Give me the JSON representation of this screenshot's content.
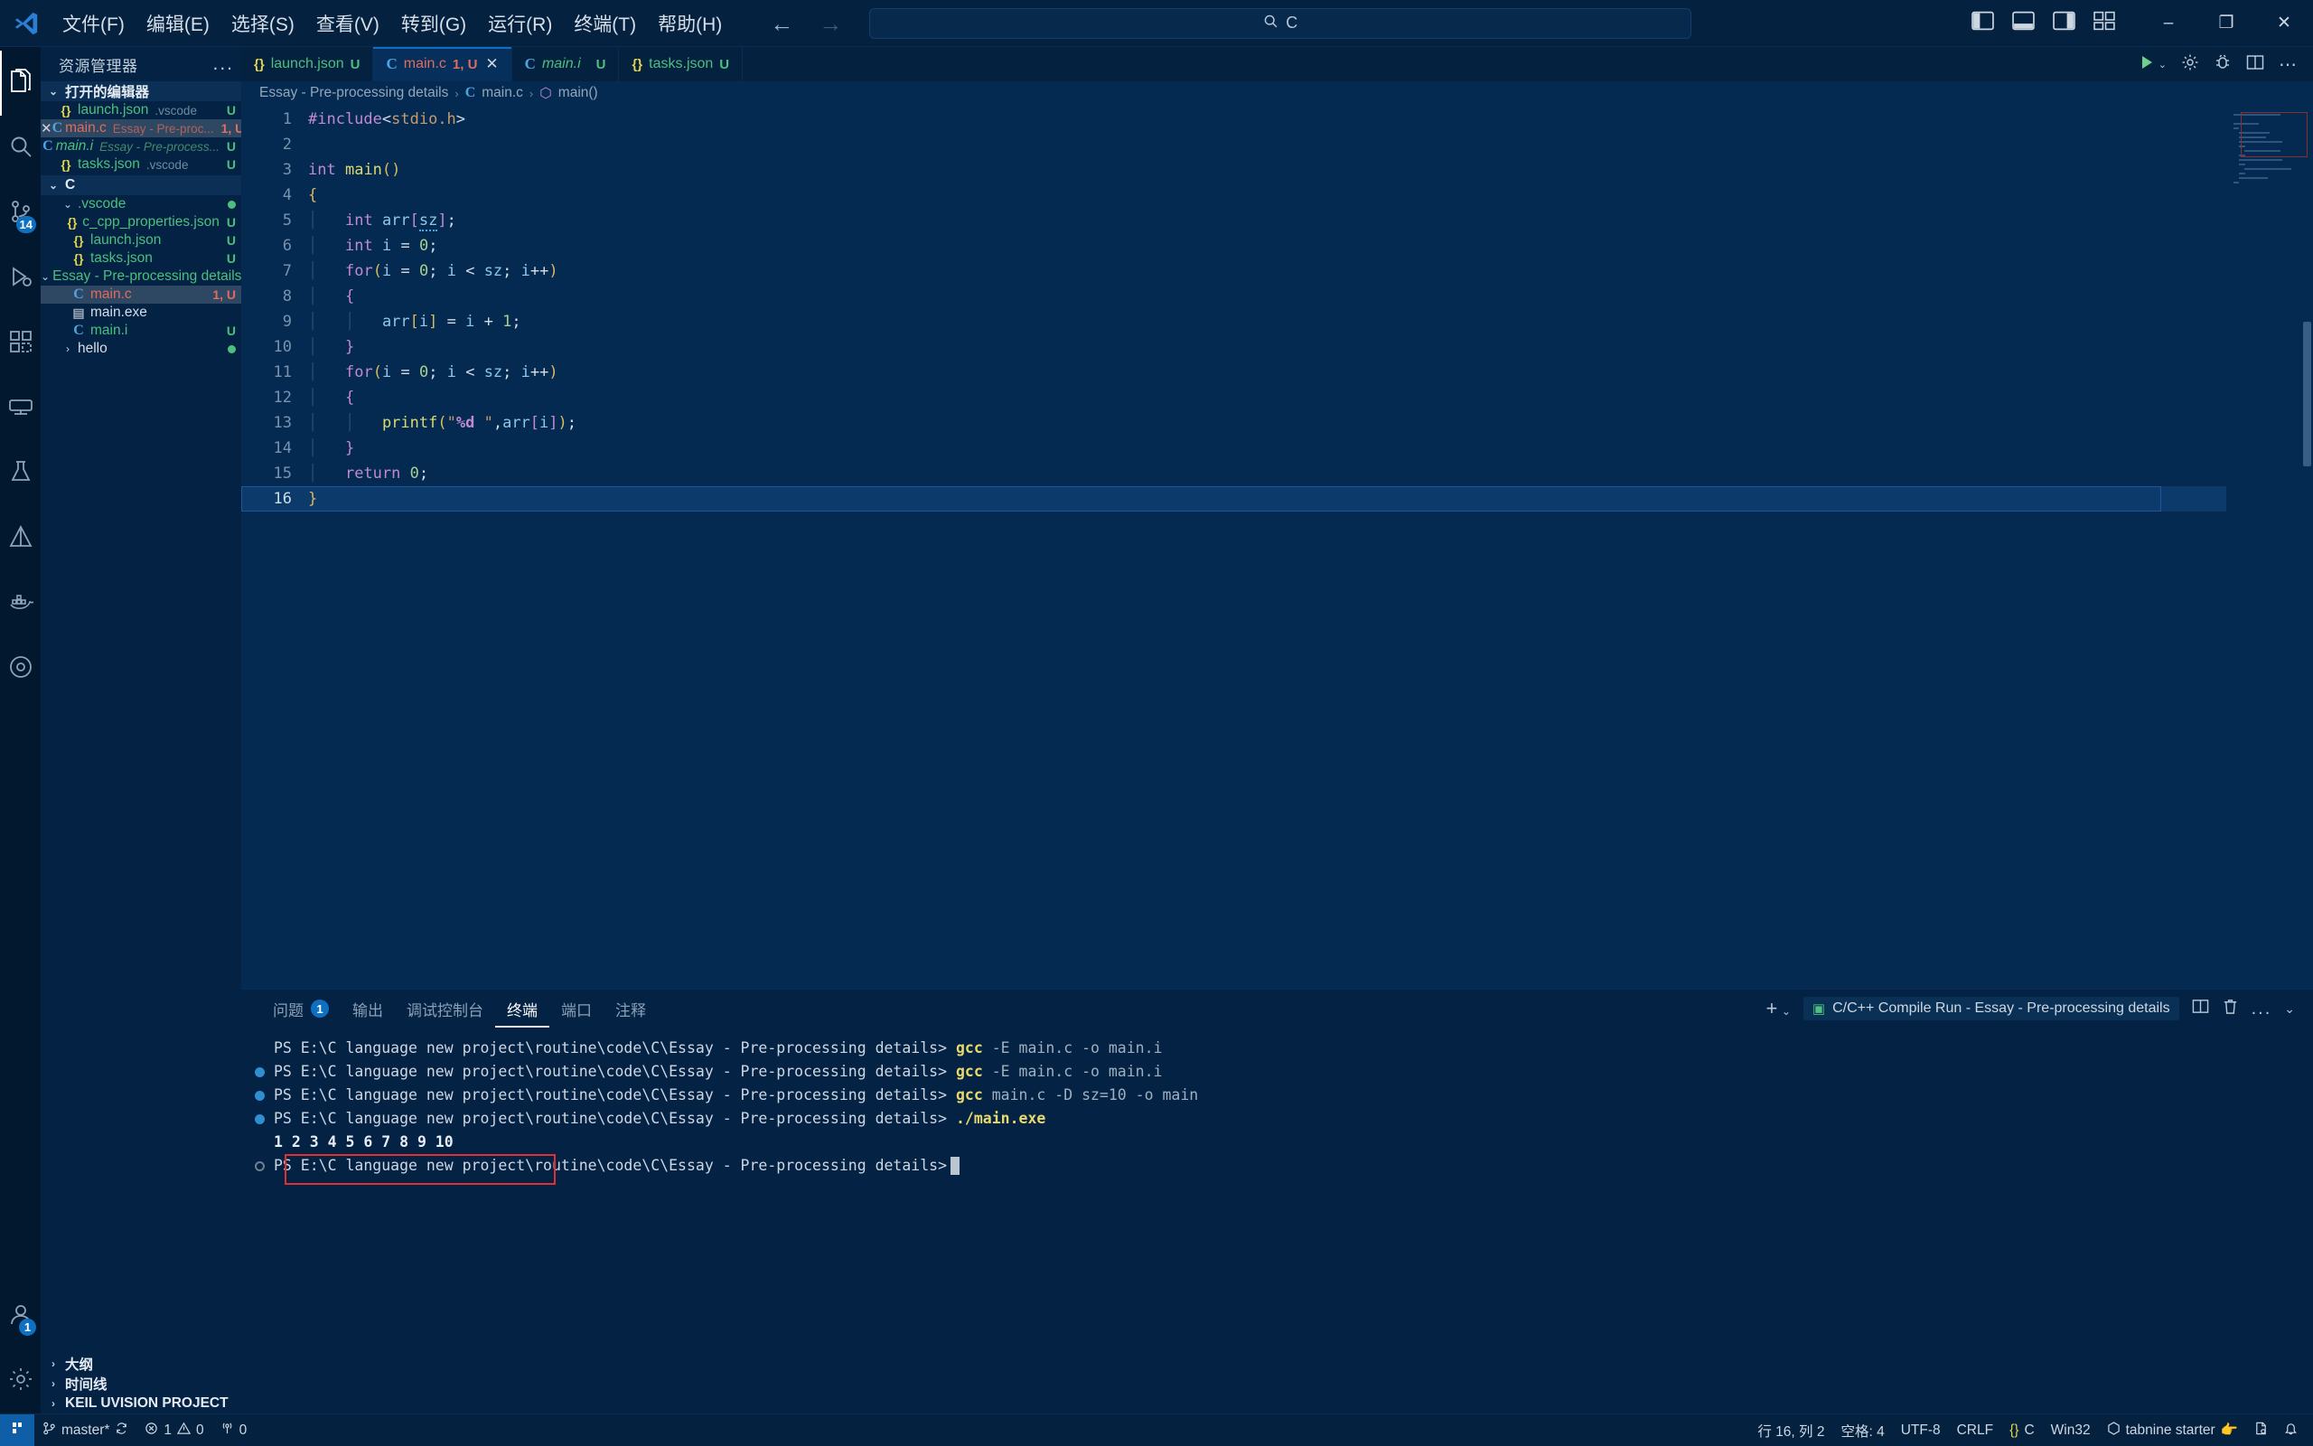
{
  "window": {
    "menu_items": [
      "文件(F)",
      "编辑(E)",
      "选择(S)",
      "查看(V)",
      "转到(G)",
      "运行(R)",
      "终端(T)",
      "帮助(H)"
    ],
    "search_placeholder": "C",
    "back_arrow": "←",
    "forward_arrow": "→",
    "minimize": "–",
    "maximize": "❐",
    "close": "✕"
  },
  "activitybar": {
    "items": [
      {
        "name": "explorer",
        "icon": "files-icon",
        "badge": ""
      },
      {
        "name": "search",
        "icon": "search-icon",
        "badge": ""
      },
      {
        "name": "source-control",
        "icon": "source-control-icon",
        "badge": "14"
      },
      {
        "name": "run-debug",
        "icon": "run-debug-icon",
        "badge": ""
      },
      {
        "name": "extensions",
        "icon": "extensions-icon",
        "badge": ""
      },
      {
        "name": "remote-explorer",
        "icon": "remote-explorer-icon",
        "badge": ""
      },
      {
        "name": "test",
        "icon": "beaker-icon",
        "badge": ""
      },
      {
        "name": "cmake",
        "icon": "cmake-icon",
        "badge": ""
      },
      {
        "name": "docker",
        "icon": "docker-icon",
        "badge": ""
      },
      {
        "name": "circle-tool",
        "icon": "circle-icon",
        "badge": ""
      }
    ],
    "bottom": [
      {
        "name": "accounts",
        "icon": "account-icon",
        "badge": "1"
      },
      {
        "name": "settings",
        "icon": "gear-icon",
        "badge": ""
      }
    ]
  },
  "sidebar": {
    "title": "资源管理器",
    "more_actions": "...",
    "open_editors": {
      "label": "打开的编辑器",
      "items": [
        {
          "icon": "json-icon",
          "name": "launch.json",
          "desc": ".vscode",
          "badge": "U",
          "badge_color": "green",
          "selected": false,
          "italic": false,
          "name_color": "green",
          "closable": false
        },
        {
          "icon": "c-icon",
          "name": "main.c",
          "desc": "Essay - Pre-proc...",
          "badge": "1, U",
          "badge_color": "red",
          "selected": true,
          "italic": false,
          "name_color": "red",
          "closable": true
        },
        {
          "icon": "c-icon",
          "name": "main.i",
          "desc": "Essay - Pre-process...",
          "badge": "U",
          "badge_color": "green",
          "selected": false,
          "italic": true,
          "name_color": "green",
          "closable": false
        },
        {
          "icon": "json-icon",
          "name": "tasks.json",
          "desc": ".vscode",
          "badge": "U",
          "badge_color": "green",
          "selected": false,
          "italic": false,
          "name_color": "green",
          "closable": false
        }
      ]
    },
    "workspace": {
      "label": "C",
      "items": [
        {
          "depth": 1,
          "type": "folder",
          "name": ".vscode",
          "icon": "chevron-down-icon",
          "badge": "",
          "dot": "green",
          "name_color": "green"
        },
        {
          "depth": 2,
          "type": "file",
          "name": "c_cpp_properties.json",
          "icon": "json-icon",
          "badge": "U",
          "name_color": "green"
        },
        {
          "depth": 2,
          "type": "file",
          "name": "launch.json",
          "icon": "json-icon",
          "badge": "U",
          "name_color": "green"
        },
        {
          "depth": 2,
          "type": "file",
          "name": "tasks.json",
          "icon": "json-icon",
          "badge": "U",
          "name_color": "green"
        },
        {
          "depth": 1,
          "type": "folder",
          "name": "Essay - Pre-processing details",
          "icon": "chevron-down-icon",
          "badge": "",
          "dot": "amber",
          "name_color": "green"
        },
        {
          "depth": 2,
          "type": "file",
          "name": "main.c",
          "icon": "c-icon",
          "badge": "1, U",
          "name_color": "red",
          "selected": true
        },
        {
          "depth": 2,
          "type": "file",
          "name": "main.exe",
          "icon": "exe-icon",
          "badge": "",
          "name_color": "white"
        },
        {
          "depth": 2,
          "type": "file",
          "name": "main.i",
          "icon": "c-icon",
          "badge": "U",
          "name_color": "green"
        },
        {
          "depth": 1,
          "type": "folder-collapsed",
          "name": "hello",
          "icon": "chevron-right-icon",
          "badge": "",
          "dot": "green",
          "name_color": "white"
        }
      ]
    },
    "collapsed_sections": [
      "大纲",
      "时间线",
      "KEIL UVISION PROJECT"
    ]
  },
  "tabs": [
    {
      "icon": "json-icon",
      "label": "launch.json",
      "badge": "U",
      "active": false,
      "italic": false,
      "color": "green",
      "closable": false
    },
    {
      "icon": "c-icon",
      "label": "main.c",
      "badge": "1, U",
      "active": true,
      "italic": false,
      "color": "red",
      "closable": true
    },
    {
      "icon": "c-icon",
      "label": "main.i",
      "badge": "U",
      "active": false,
      "italic": true,
      "color": "green",
      "closable": false
    },
    {
      "icon": "json-icon",
      "label": "tasks.json",
      "badge": "U",
      "active": false,
      "italic": false,
      "color": "green",
      "closable": false
    }
  ],
  "editor": {
    "breadcrumb": {
      "folder": "Essay - Pre-processing details",
      "file": "main.c",
      "symbol": "main()"
    },
    "lines": [
      {
        "n": "1",
        "text": "#include<stdio.h>"
      },
      {
        "n": "2",
        "text": ""
      },
      {
        "n": "3",
        "text": "int main()"
      },
      {
        "n": "4",
        "text": "{"
      },
      {
        "n": "5",
        "text": "    int arr[sz];"
      },
      {
        "n": "6",
        "text": "    int i = 0;"
      },
      {
        "n": "7",
        "text": "    for(i = 0; i < sz; i++)"
      },
      {
        "n": "8",
        "text": "    {"
      },
      {
        "n": "9",
        "text": "        arr[i] = i + 1;"
      },
      {
        "n": "10",
        "text": "    }"
      },
      {
        "n": "11",
        "text": "    for(i = 0; i < sz; i++)"
      },
      {
        "n": "12",
        "text": "    {"
      },
      {
        "n": "13",
        "text": "        printf(\"%d \",arr[i]);"
      },
      {
        "n": "14",
        "text": "    }"
      },
      {
        "n": "15",
        "text": "    return 0;"
      },
      {
        "n": "16",
        "text": "}"
      }
    ]
  },
  "panel": {
    "tabs": [
      {
        "label": "问题",
        "badge": "1",
        "active": false
      },
      {
        "label": "输出",
        "badge": "",
        "active": false
      },
      {
        "label": "调试控制台",
        "badge": "",
        "active": false
      },
      {
        "label": "终端",
        "badge": "",
        "active": true
      },
      {
        "label": "端口",
        "badge": "",
        "active": false
      },
      {
        "label": "注释",
        "badge": "",
        "active": false
      }
    ],
    "add_button": "+",
    "terminal_selector": "C/C++ Compile Run - Essay - Pre-processing details",
    "split_button": "split-editor-icon",
    "kill_button": "trash-icon",
    "more_button": "...",
    "chevron_up": "chevron-up-icon",
    "terminal": {
      "prompt": "PS E:\\C language new project\\routine\\code\\C\\Essay - Pre-processing details>",
      "lines": [
        {
          "mark": "none",
          "prompt": true,
          "cmd": "gcc",
          "flags": " -E main.c -o main.i"
        },
        {
          "mark": "blue",
          "prompt": true,
          "cmd": "gcc",
          "flags": " -E main.c -o main.i"
        },
        {
          "mark": "blue",
          "prompt": true,
          "cmd": "gcc",
          "flags": " main.c -D sz=10 -o main"
        },
        {
          "mark": "blue",
          "prompt": true,
          "cmd": "./main.exe",
          "flags": ""
        },
        {
          "mark": "none",
          "prompt": false,
          "output": "1 2 3 4 5 6 7 8 9 10"
        },
        {
          "mark": "hollow",
          "prompt": true,
          "cmd": "",
          "flags": "",
          "cursor": true
        }
      ]
    }
  },
  "statusbar": {
    "remote": "master*",
    "sync": "sync-icon",
    "errors": "1",
    "warnings": "0",
    "ports": "0",
    "line_col": "行 16, 列 2",
    "indent": "空格: 4",
    "encoding": "UTF-8",
    "eol": "CRLF",
    "language": "C",
    "platform": "Win32",
    "tabnine": "tabnine starter",
    "notifications": "bell-icon",
    "feedback": "feedback-icon"
  }
}
